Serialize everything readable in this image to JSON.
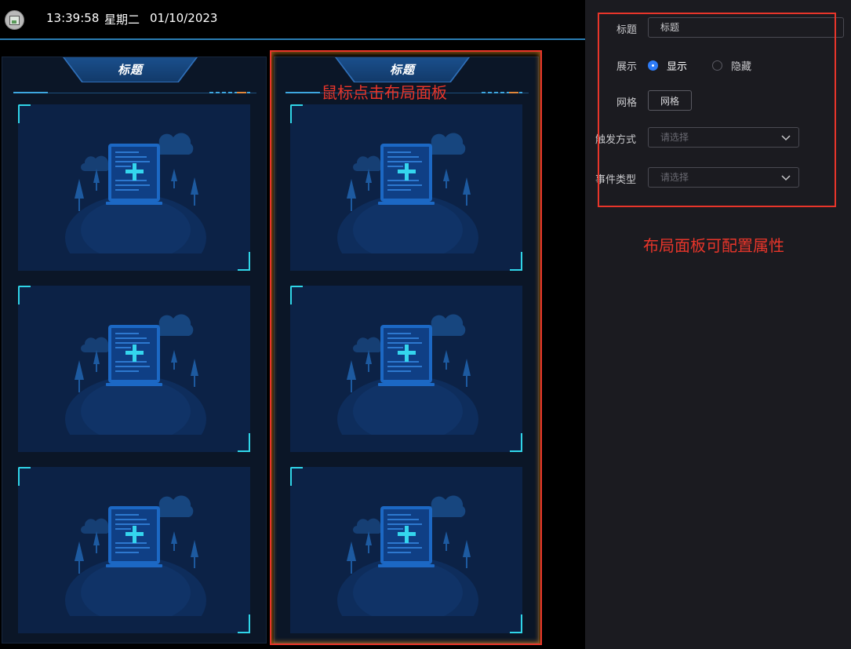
{
  "header": {
    "time": "13:39:58",
    "weekday": "星期二",
    "date": "01/10/2023"
  },
  "canvas": {
    "panels": [
      {
        "title": "标题"
      },
      {
        "title": "标题"
      }
    ],
    "annotation": "鼠标点击布局面板"
  },
  "config": {
    "title_label": "标题",
    "title_value": "标题",
    "display_label": "展示",
    "display_options": [
      "显示",
      "隐藏"
    ],
    "display_selected": "显示",
    "grid_label": "网格",
    "grid_button": "网格",
    "trigger_label": "触发方式",
    "trigger_placeholder": "请选择",
    "event_label": "事件类型",
    "event_placeholder": "请选择",
    "annotation": "布局面板可配置属性"
  },
  "colors": {
    "accent_line": "#2a7db3",
    "selection": "#e8352a",
    "radio_on": "#2e7cf6",
    "cell_bg": "#0c2246",
    "corner": "#30d5e8"
  }
}
